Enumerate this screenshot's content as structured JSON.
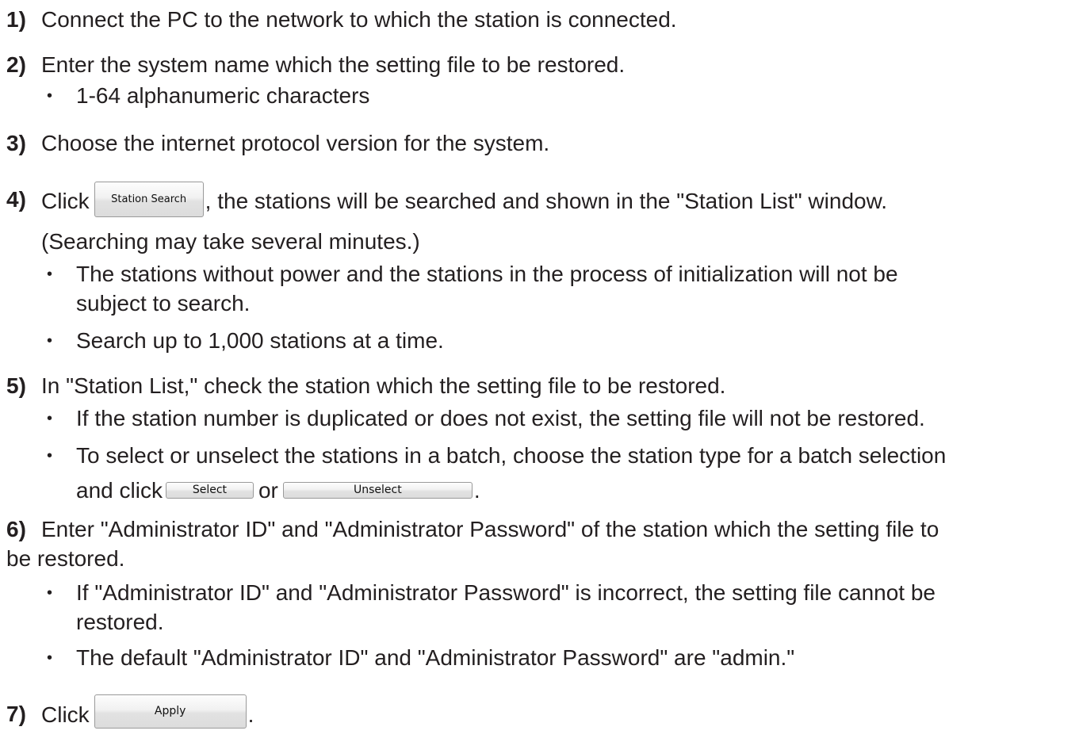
{
  "steps": [
    {
      "num": "1)",
      "text": "Connect the PC to the network to which the station is connected."
    },
    {
      "num": "2)",
      "text": "Enter the system name which the setting file to be restored.",
      "bullets": [
        "1-64 alphanumeric characters"
      ]
    },
    {
      "num": "3)",
      "text": "Choose the internet protocol version for the system."
    },
    {
      "num": "4)",
      "text_before": "Click",
      "button": "Station Search",
      "text_after": ", the stations will be searched and shown in the \"Station List\" window.",
      "line2": "(Searching may take several minutes.)",
      "bullets": [
        "The stations without power and the stations in the process of initialization will not be",
        "subject to search.",
        "Search up to 1,000 stations at a time."
      ]
    },
    {
      "num": "5)",
      "text": "In \"Station List,\" check the station which the setting file to be restored.",
      "bullets": [
        "If the station number is duplicated or does not exist, the setting file will not be restored.",
        "To select or unselect the stations in a batch, choose the station type for a batch selection"
      ],
      "bullet2_line2_before": "and click",
      "select_button": "Select",
      "or_text": "or",
      "unselect_button": "Unselect",
      "bullet2_line2_after": "."
    },
    {
      "num": "6)",
      "text": "Enter \"Administrator ID\" and \"Administrator Password\" of the station which the setting file to",
      "line2": "be restored.",
      "bullets": [
        "If \"Administrator ID\" and \"Administrator Password\" is incorrect, the setting file cannot be",
        "restored.",
        "The default \"Administrator ID\" and \"Administrator Password\" are \"admin.\""
      ]
    },
    {
      "num": "7)",
      "text_before": "Click",
      "button": "Apply",
      "text_after": "."
    }
  ],
  "bullet_glyph": "•"
}
